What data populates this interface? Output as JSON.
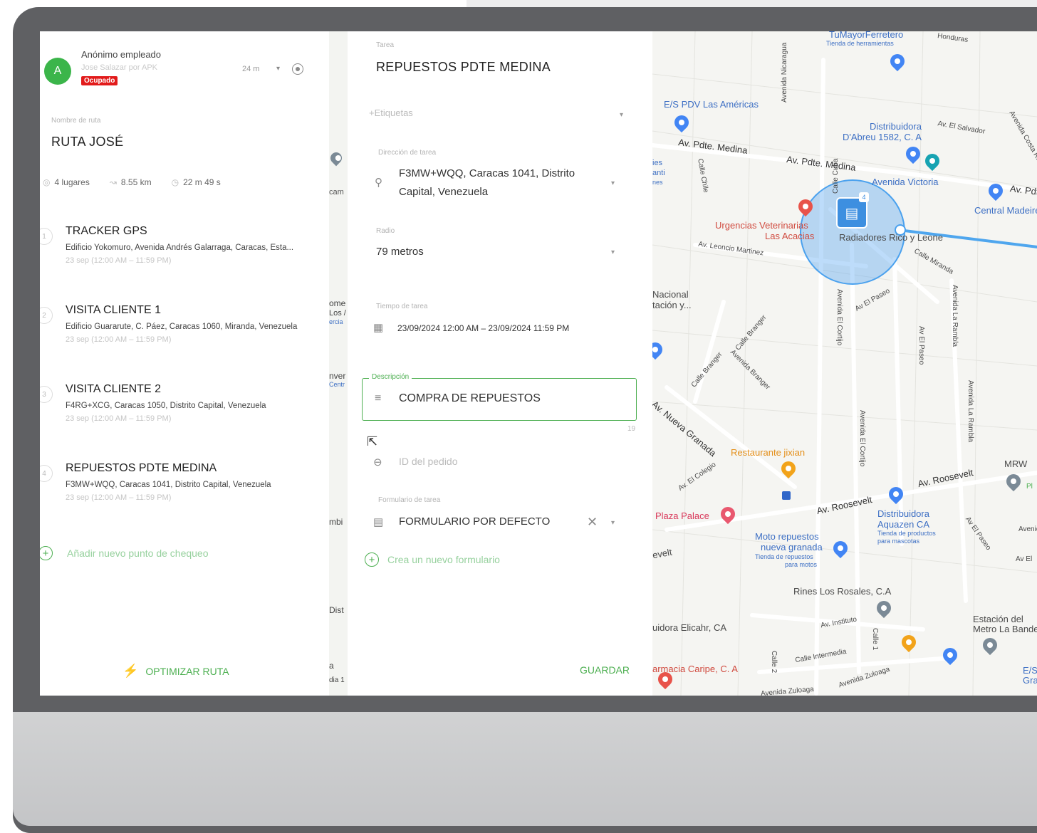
{
  "employee": {
    "avatar_letter": "A",
    "name": "Anónimo empleado",
    "sub": "Jose Salazar por APK",
    "status_badge": "Ocupado",
    "time_window": "24 m"
  },
  "route": {
    "name_label": "Nombre de ruta",
    "name": "RUTA JOSÉ",
    "stats": {
      "places": "4 lugares",
      "distance": "8.55 km",
      "duration": "22 m 49 s"
    },
    "stops": [
      {
        "num": "1",
        "title": "TRACKER GPS",
        "address": "Edificio Yokomuro, Avenida Andrés Galarraga, Caracas, Esta...",
        "time": "23 sep (12:00 AM – 11:59 PM)"
      },
      {
        "num": "2",
        "title": "VISITA CLIENTE 1",
        "address": "Edificio Guararute, C. Páez, Caracas 1060, Miranda, Venezuela",
        "time": "23 sep (12:00 AM – 11:59 PM)"
      },
      {
        "num": "3",
        "title": "VISITA CLIENTE 2",
        "address": "F4RG+XCG, Caracas 1050, Distrito Capital, Venezuela",
        "time": "23 sep (12:00 AM – 11:59 PM)"
      },
      {
        "num": "4",
        "title": "REPUESTOS PDTE MEDINA",
        "address": "F3MW+WQQ, Caracas 1041, Distrito Capital, Venezuela",
        "time": "23 sep (12:00 AM – 11:59 PM)"
      }
    ],
    "add_checkpoint": "Añadir nuevo punto de chequeo",
    "optimize": "OPTIMIZAR RUTA"
  },
  "task": {
    "task_label": "Tarea",
    "task_name": "REPUESTOS PDTE MEDINA",
    "tags_placeholder": "+Etiquetas",
    "address_label": "Dirección de tarea",
    "address_line1": "F3MW+WQQ, Caracas 1041, Distrito",
    "address_line2": "Capital, Venezuela",
    "radius_label": "Radio",
    "radius_value": "79 metros",
    "time_label": "Tiempo de tarea",
    "time_value": "23/09/2024 12:00 AM – 23/09/2024 11:59 PM",
    "description_label": "Descripción",
    "description_value": "COMPRA DE REPUESTOS",
    "description_count": "19",
    "order_id_placeholder": "ID del pedido",
    "form_label": "Formulario de tarea",
    "form_value": "FORMULARIO POR DEFECTO",
    "new_form": "Crea un nuevo formulario",
    "save": "GUARDAR"
  },
  "strip_labels": [
    "cam",
    "ome",
    "Los /",
    "ercia",
    "nver",
    "Centr",
    "mbi",
    "Dist",
    "a",
    "dia 1"
  ],
  "map": {
    "labels": {
      "tumayor": "TuMayorFerretero",
      "tumayor_sub": "Tienda de herramientas",
      "honduras": "Honduras",
      "es_pdv": "E/S PDV Las Américas",
      "av_nicaragua": "Avenida Nicaragua",
      "distribuidora_dabreu": "Distribuidora",
      "distribuidora_dabreu2": "D'Abreu 1582, C. A",
      "av_el_salvador": "Av. El Salvador",
      "av_costa_rica": "Avenida Costa Rica",
      "av_pdte_medina_1": "Av. Pdte. Medina",
      "av_pdte_medina_2": "Av. Pdte. Medina",
      "avenida_victoria": "Avenida Victoria",
      "av_p": "Av. Pdte",
      "central_madeirense": "Central Madeirense",
      "calle_chile": "Calle Chile",
      "calle_cuba": "Calle Cuba",
      "urgencias": "Urgencias Veterinarias",
      "urgencias2": "Las Acacias",
      "radiadores": "Radiadores Rico y Leone",
      "av_leoncio": "Av. Leoncio Martinez",
      "calle_miranda": "Calle Miranda",
      "nacional": "Nacional",
      "nacional2": "tación y...",
      "av_el_paseo_1": "Av El Paseo",
      "avenida_el_cortijo_1": "Avenida El Cortijo",
      "av_el_paseo_2": "Av El Paseo",
      "avenida_la_rambla_1": "Avenida La Rambla",
      "calle_branger": "Calle Branger",
      "calle_branger2": "Calle Branger",
      "avenida_branger": "Avenida Branger",
      "av_nueva_granada": "Av. Nueva Granada",
      "avenida_el_cortijo_2": "Avenida El Cortijo",
      "avenida_la_rambla_2": "Avenida La Rambla",
      "restaurante": "Restaurante jixian",
      "mrw": "MRW",
      "av_el_colegio": "Av. El Colegio",
      "av_roosevelt_1": "Av. Roosevelt",
      "av_roosevelt_2": "Av. Roosevelt",
      "plaza_palace": "Plaza Palace",
      "distribuidora_aquazen": "Distribuidora",
      "distribuidora_aquazen2": "Aquazen CA",
      "aquazen_sub": "Tienda de productos",
      "aquazen_sub2": "para mascotas",
      "av_el_paseo_3": "Av El Paseo",
      "avenida_r": "Avenida",
      "moto_repuestos": "Moto repuestos",
      "moto_repuestos2": "nueva granada",
      "moto_sub": "Tienda de repuestos",
      "moto_sub2": "para motos",
      "roosevelt_edge": "evelt",
      "av_el_edge": "Av El",
      "rines": "Rines Los Rosales, C.A",
      "av_instituto": "Av. Instituto",
      "calle_1": "Calle 1",
      "distribuidora_elicahr": "uidora Elicahr, CA",
      "estacion": "Estación del",
      "estacion2": "Metro La Bandera",
      "calle_intermedia": "Calle Intermedia",
      "calle_2": "Calle 2",
      "farmacia": "armacia Caripe, C. A",
      "es_gran": "E/S",
      "es_gran2": "Gra",
      "avenida_zuloaga_1": "Avenida Zuloaga",
      "avenida_zuloaga_2": "Avenida Zuloaga",
      "ies": "ies",
      "anti": "anti",
      "nes": "nes",
      "pl": "Pl",
      "geofence_count": "4"
    }
  },
  "colors": {
    "accent": "#4caf50",
    "busy": "#e21b1b",
    "geofence": "#4aa1ee"
  }
}
